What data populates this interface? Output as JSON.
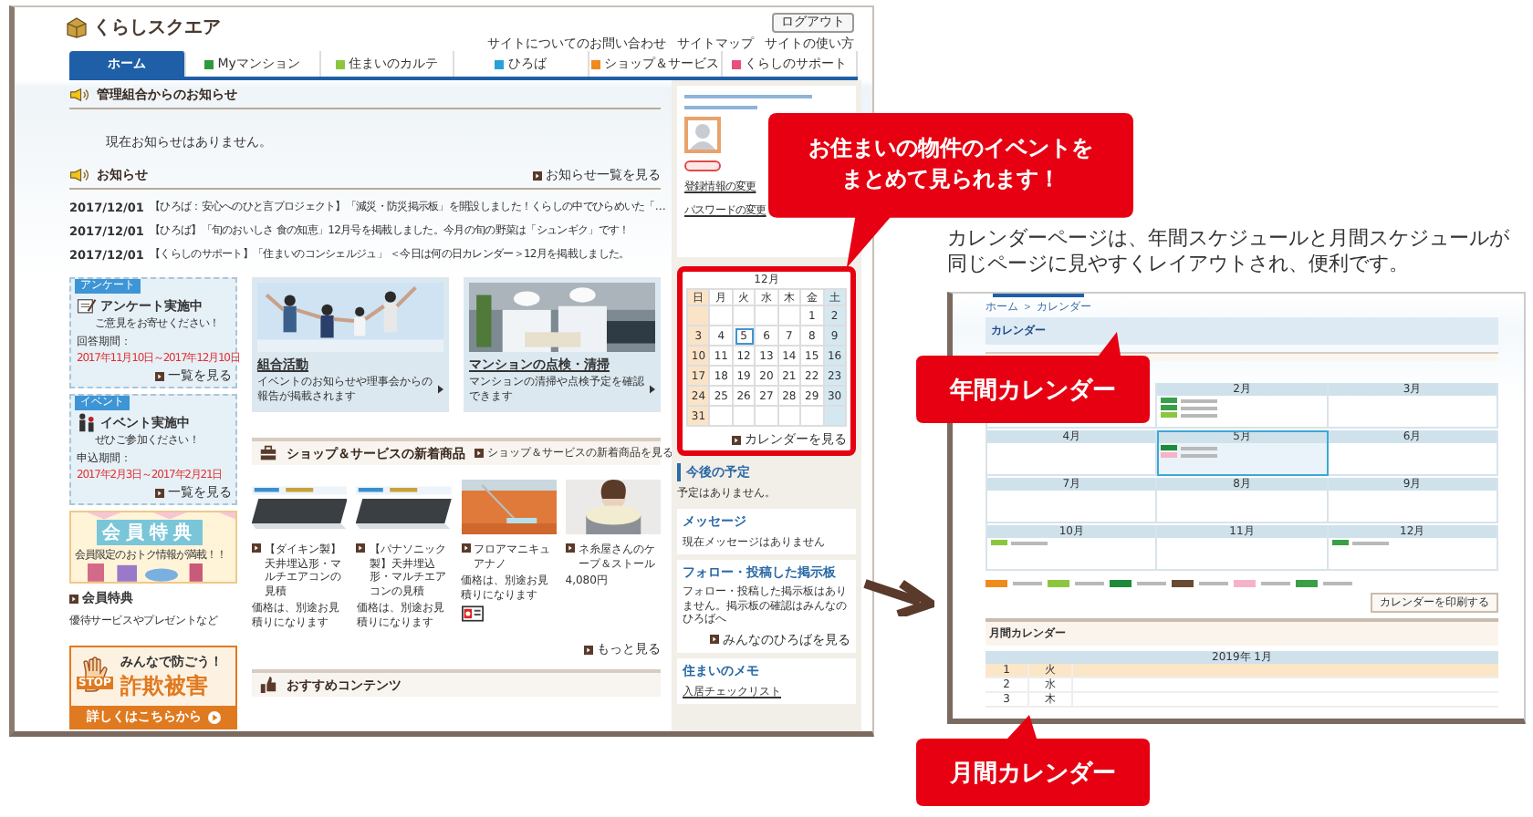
{
  "site": {
    "logo": "くらしスクエア",
    "logout": "ログアウト",
    "top_links": [
      "サイトについてのお問い合わせ",
      "サイトマップ",
      "サイトの使い方"
    ]
  },
  "nav": [
    {
      "label": "ホーム",
      "selected": true,
      "color": "#1f5fa8"
    },
    {
      "label": "Myマンション",
      "selected": false,
      "color": "#2e9a3c"
    },
    {
      "label": "住まいのカルテ",
      "selected": false,
      "color": "#8cc63f"
    },
    {
      "label": "ひろば",
      "selected": false,
      "color": "#2aa0d8"
    },
    {
      "label": "ショップ＆サービス",
      "selected": false,
      "color": "#f08a1d"
    },
    {
      "label": "くらしのサポート",
      "selected": false,
      "color": "#e8507a"
    }
  ],
  "admin_notice": {
    "title": "管理組合からのお知らせ",
    "message": "現在お知らせはありません。"
  },
  "news": {
    "title": "お知らせ",
    "more": "お知らせ一覧を見る",
    "items": [
      {
        "date": "2017/12/01",
        "text": "【ひろば：安心へのひと言プロジェクト】「減災・防災掲示板」を開設しました！くらしの中でひらめいた「…"
      },
      {
        "date": "2017/12/01",
        "text": "【ひろば】「旬のおいしさ 食の知恵」12月号を掲載しました。今月の旬の野菜は「シュンギク」です！"
      },
      {
        "date": "2017/12/01",
        "text": "【くらしのサポート】「住まいのコンシェルジュ」 ＜今日は何の日カレンダー＞12月を掲載しました。"
      }
    ]
  },
  "promo_cards": [
    {
      "kind": "survey",
      "tag": "アンケート",
      "title": "アンケート実施中",
      "subtitle": "ご意見をお寄せください！",
      "period_label": "回答期間：",
      "period": "2017年11月10日～2017年12月10日",
      "more": "一覧を見る"
    },
    {
      "kind": "event",
      "tag": "イベント",
      "title": "イベント実施中",
      "subtitle": "ぜひご参加ください！",
      "period_label": "申込期間：",
      "period": "2017年2月3日～2017年2月21日",
      "more": "一覧を見る"
    }
  ],
  "benefit": {
    "banner_title": "会員特典",
    "banner_subtitle": "会員限定のおトク情報が満載！！",
    "link": "会員特典",
    "description": "優待サービスやプレゼントなど"
  },
  "fraud_banner": {
    "stop": "STOP",
    "line_1": "みんなで防ごう！",
    "line_2": "詐欺被害",
    "button": "詳しくはこちらから"
  },
  "feature_cards": [
    {
      "kind": "people",
      "title": "組合活動",
      "description": "イベントのお知らせや理事会からの報告が掲載されます"
    },
    {
      "kind": "workers",
      "title": "マンションの点検・清掃",
      "description": "マンションの清掃や点検予定を確認できます"
    }
  ],
  "shop": {
    "title": "ショップ＆サービスの新着商品",
    "more": "ショップ＆サービスの新着商品を見る",
    "items": [
      {
        "kind": "aircon",
        "name": "【ダイキン製】天井埋込形・マルチエアコンの見積",
        "price": "価格は、別途お見積りになります"
      },
      {
        "kind": "aircon",
        "name": "【パナソニック製】天井埋込形・マルチエアコンの見積",
        "price": "価格は、別途お見積りになります"
      },
      {
        "kind": "floor",
        "name": "フロアマニキュアナノ",
        "price": "価格は、別途お見積りになります",
        "badge": true
      },
      {
        "kind": "scarf",
        "name": "ネ糸屋さんのケープ＆ストール",
        "price": "4,080円"
      }
    ],
    "more_link": "もっと見る"
  },
  "recommend": {
    "title": "おすすめコンテンツ"
  },
  "sidebar": {
    "links": [
      "登録情報の変更",
      "パスワードの変更"
    ],
    "calendar": {
      "month": "12月",
      "weekdays": [
        "日",
        "月",
        "火",
        "水",
        "木",
        "金",
        "土"
      ],
      "more": "カレンダーを見る",
      "weeks": [
        {
          "kind": "first",
          "days": [
            {
              "day": "1",
              "selected": false
            },
            {
              "day": "2",
              "selected": false
            }
          ]
        },
        {
          "days": [
            {
              "day": "3",
              "selected": false
            },
            {
              "day": "4",
              "selected": false
            },
            {
              "day": "5",
              "selected": true
            },
            {
              "day": "6",
              "selected": false
            },
            {
              "day": "7",
              "selected": false
            },
            {
              "day": "8",
              "selected": false
            },
            {
              "day": "9",
              "selected": false
            }
          ]
        },
        {
          "days": [
            {
              "day": "10",
              "selected": false
            },
            {
              "day": "11",
              "selected": false
            },
            {
              "day": "12",
              "selected": false
            },
            {
              "day": "13",
              "selected": false
            },
            {
              "day": "14",
              "selected": false
            },
            {
              "day": "15",
              "selected": false
            },
            {
              "day": "16",
              "selected": false
            }
          ]
        },
        {
          "days": [
            {
              "day": "17",
              "selected": false
            },
            {
              "day": "18",
              "selected": false
            },
            {
              "day": "19",
              "selected": false
            },
            {
              "day": "20",
              "selected": false
            },
            {
              "day": "21",
              "selected": false
            },
            {
              "day": "22",
              "selected": false
            },
            {
              "day": "23",
              "selected": false
            }
          ]
        },
        {
          "days": [
            {
              "day": "24",
              "selected": false
            },
            {
              "day": "25",
              "selected": false
            },
            {
              "day": "26",
              "selected": false
            },
            {
              "day": "27",
              "selected": false
            },
            {
              "day": "28",
              "selected": false
            },
            {
              "day": "29",
              "selected": false
            },
            {
              "day": "30",
              "selected": false
            }
          ]
        },
        {
          "kind": "last",
          "days": [
            {
              "day": "31",
              "selected": false
            }
          ]
        }
      ]
    },
    "schedule": {
      "title": "今後の予定",
      "message": "予定はありません。"
    },
    "messages": {
      "title": "メッセージ",
      "message": "現在メッセージはありません"
    },
    "boards": {
      "title": "フォロー・投稿した掲示板",
      "message": "フォロー・投稿した掲示板はありません。掲示板の確認はみんなのひろばへ",
      "more": "みんなのひろばを見る"
    },
    "memo": {
      "title": "住まいのメモ",
      "link": "入居チェックリスト"
    }
  },
  "callouts": {
    "event": "お住まいの物件のイベントをまとめて見られます！",
    "yearly": "年間カレンダー",
    "monthly": "月間カレンダー"
  },
  "description": "カレンダーページは、年間スケジュールと月間スケジュールが同じページに見やすくレイアウトされ、便利です。",
  "calendar_page": {
    "breadcrumb": "ホーム ＞ カレンダー",
    "title": "カレンダー",
    "months": [
      {
        "label": "2月",
        "selected": false,
        "events": [
          {
            "color": "#3aa048"
          },
          {
            "color": "#3aa048"
          },
          {
            "color": "#8cc63f"
          }
        ]
      },
      {
        "label": "3月",
        "selected": false
      },
      {
        "label": "4月",
        "selected": false
      },
      {
        "label": "5月",
        "selected": true,
        "events": [
          {
            "color": "#1e8a3a"
          },
          {
            "color": "#f6b3c8"
          }
        ]
      },
      {
        "label": "6月",
        "selected": false
      },
      {
        "label": "7月",
        "selected": false
      },
      {
        "label": "8月",
        "selected": false
      },
      {
        "label": "9月",
        "selected": false
      },
      {
        "label": "10月",
        "selected": false,
        "events": [
          {
            "color": "#8cc63f"
          }
        ]
      },
      {
        "label": "11月",
        "selected": false
      },
      {
        "label": "12月",
        "selected": false,
        "events": [
          {
            "color": "#3aa048"
          }
        ]
      }
    ],
    "legend": [
      {
        "color": "#f08a1d"
      },
      {
        "color": "#8cc63f"
      },
      {
        "color": "#1e8a3a"
      },
      {
        "color": "#6b4a32"
      },
      {
        "color": "#f6b3c8"
      },
      {
        "color": "#3aa048"
      }
    ],
    "print_button": "カレンダーを印刷する",
    "monthly_title": "月間カレンダー",
    "month_heading": "2019年 1月",
    "rows": [
      {
        "day": "1",
        "weekday": "火",
        "selected": true
      },
      {
        "day": "2",
        "weekday": "水",
        "selected": false
      },
      {
        "day": "3",
        "weekday": "木",
        "selected": false
      }
    ]
  }
}
